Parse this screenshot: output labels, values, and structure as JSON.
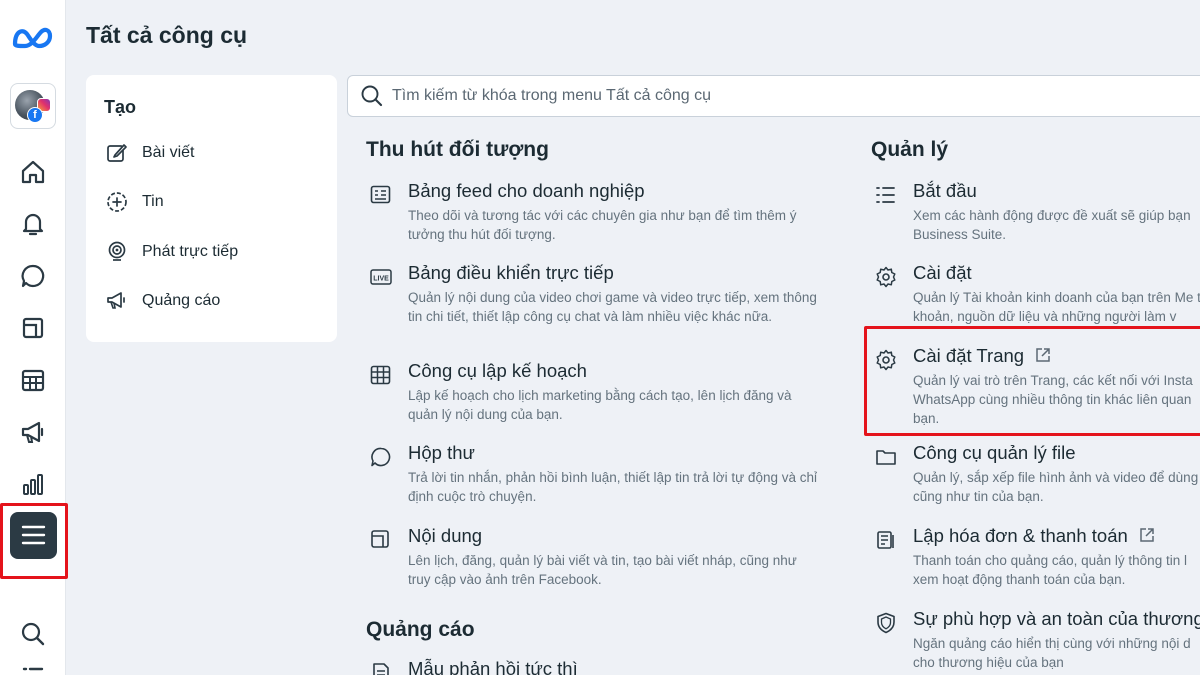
{
  "colors": {
    "accent": "#1877f2",
    "highlight": "#e4131b",
    "rail_active": "#2b3a44"
  },
  "rail": {
    "logo_icon": "meta-logo-icon",
    "avatar_icons": [
      "profile-avatar",
      "instagram-icon",
      "facebook-icon"
    ],
    "facebook_letter": "f",
    "items": [
      "home-icon",
      "bell-icon",
      "chat-icon",
      "content-icon",
      "planner-icon",
      "megaphone-icon",
      "insights-icon",
      "all-tools-menu-icon",
      "search-icon"
    ]
  },
  "header": {
    "title": "Tất cả công cụ"
  },
  "create": {
    "heading": "Tạo",
    "items": [
      {
        "label": "Bài viết",
        "icon": "edit-icon"
      },
      {
        "label": "Tin",
        "icon": "add-story-icon"
      },
      {
        "label": "Phát trực tiếp",
        "icon": "live-icon"
      },
      {
        "label": "Quảng cáo",
        "icon": "megaphone-icon"
      }
    ]
  },
  "search": {
    "placeholder": "Tìm kiếm từ khóa trong menu Tất cả công cụ"
  },
  "engage": {
    "title": "Thu hút đối tượng",
    "tools": [
      {
        "name": "Bảng feed cho doanh nghiệp",
        "desc": "Theo dõi và tương tác với các chuyên gia như bạn để tìm thêm ý tưởng thu hút đối tượng.",
        "icon": "feed-icon"
      },
      {
        "name": "Bảng điều khiển trực tiếp",
        "desc": "Quản lý nội dung của video chơi game và video trực tiếp, xem thông tin chi tiết, thiết lập công cụ chat và làm nhiều việc khác nữa.",
        "icon": "live-badge-icon",
        "badge": "LIVE"
      },
      {
        "name": "Công cụ lập kế hoạch",
        "desc": "Lập kế hoạch cho lịch marketing bằng cách tạo, lên lịch đăng và quản lý nội dung của bạn.",
        "icon": "calendar-grid-icon"
      },
      {
        "name": "Hộp thư",
        "desc": "Trả lời tin nhắn, phản hồi bình luận, thiết lập tin trả lời tự động và chỉ định cuộc trò chuyện.",
        "icon": "inbox-bubble-icon"
      },
      {
        "name": "Nội dung",
        "desc": "Lên lịch, đăng, quản lý bài viết và tin, tạo bài viết nháp, cũng như truy cập vào ảnh trên Facebook.",
        "icon": "content-stack-icon"
      }
    ]
  },
  "ads": {
    "title": "Quảng cáo",
    "tools": [
      {
        "name": "Mẫu phản hồi tức thì",
        "icon": "form-icon"
      }
    ]
  },
  "manage": {
    "title": "Quản lý",
    "tools": [
      {
        "name": "Bắt đầu",
        "desc": "Xem các hành động được đề xuất sẽ giúp bạn Business Suite.",
        "icon": "list-icon"
      },
      {
        "name": "Cài đặt",
        "desc": "Quản lý Tài khoản kinh doanh của bạn trên Me tài khoản, nguồn dữ liệu và những người làm v",
        "icon": "gear-icon"
      },
      {
        "name": "Cài đặt Trang",
        "desc": "Quản lý vai trò trên Trang, các kết nối với Insta WhatsApp cùng nhiều thông tin khác liên quan bạn.",
        "icon": "gear-icon",
        "external": true
      },
      {
        "name": "Công cụ quản lý file",
        "desc": "Quản lý, sắp xếp file hình ảnh và video để dùng cũng như tin của bạn.",
        "icon": "folder-icon"
      },
      {
        "name": "Lập hóa đơn & thanh toán",
        "desc": "Thanh toán cho quảng cáo, quản lý thông tin l xem hoạt động thanh toán của bạn.",
        "icon": "billing-icon",
        "external": true
      },
      {
        "name": "Sự phù hợp và an toàn của thương",
        "desc": "Ngăn quảng cáo hiển thị cùng với những nội d cho thương hiệu của bạn",
        "icon": "shield-icon"
      }
    ]
  }
}
